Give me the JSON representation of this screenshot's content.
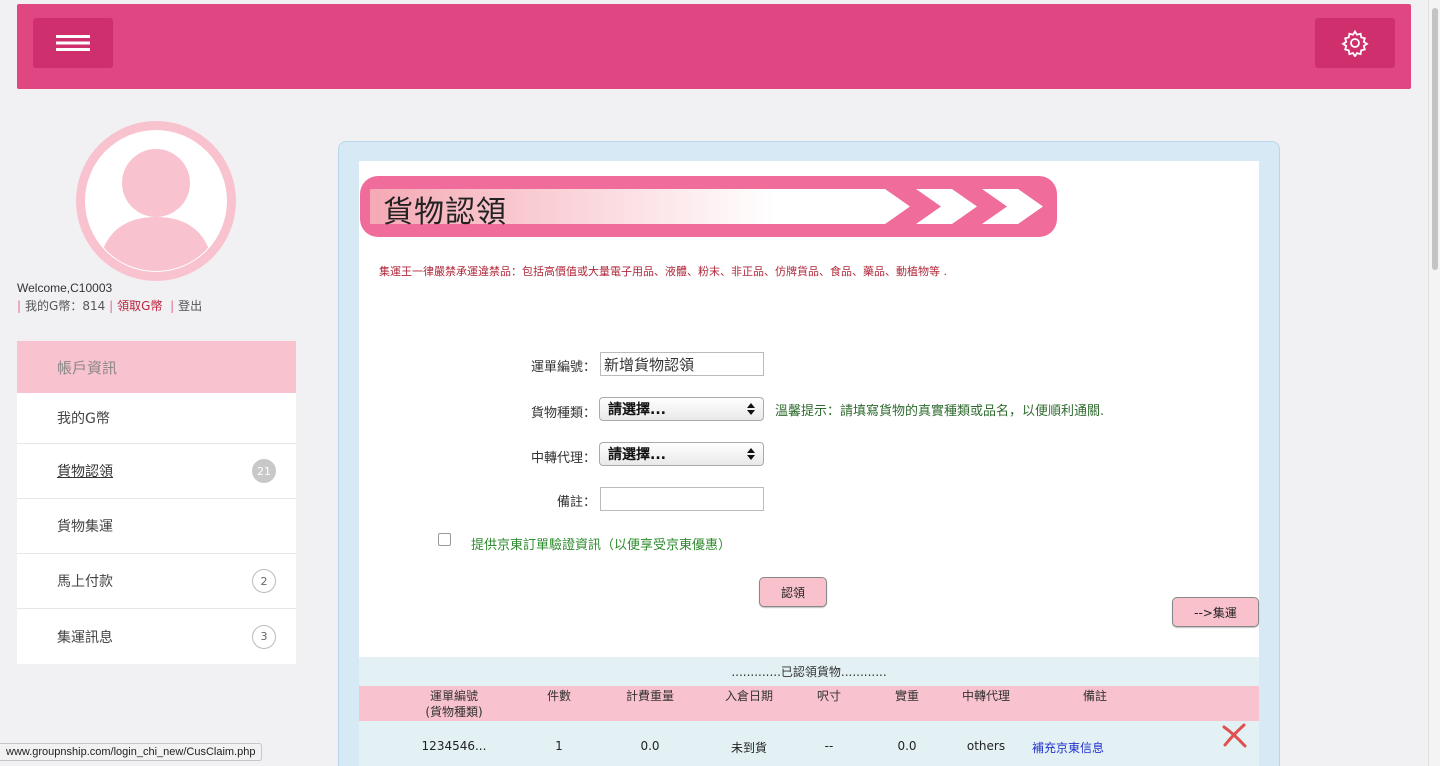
{
  "header": {
    "menu_icon": "hamburger-icon",
    "settings_icon": "gear-icon"
  },
  "user": {
    "welcome": "Welcome,C10003",
    "coins_text": "我的G幣：814",
    "get_coins": "領取G幣",
    "logout": "登出"
  },
  "sidebar": {
    "header": "帳戶資訊",
    "items": [
      {
        "label": "我的G幣",
        "badge": ""
      },
      {
        "label": "貨物認領",
        "badge": "21"
      },
      {
        "label": "貨物集運",
        "badge": ""
      },
      {
        "label": "馬上付款",
        "badge": "2"
      },
      {
        "label": "集運訊息",
        "badge": "3"
      }
    ]
  },
  "page": {
    "title": "貨物認領",
    "notice": "集運王一律嚴禁承運違禁品：包括高價值或大量電子用品、液體、粉末、非正品、仿牌貨品、食品、藥品、動植物等 ."
  },
  "form": {
    "waybill_label": "運單編號：",
    "waybill_value": "新增貨物認領",
    "type_label": "貨物種類：",
    "type_value": "請選擇...",
    "type_hint": "溫馨提示：請填寫貨物的真實種類或品名，以便順利通關.",
    "agent_label": "中轉代理：",
    "agent_value": "請選擇...",
    "remark_label": "備註：",
    "remark_value": "",
    "jd_checkbox_label": "提供京東訂單驗證資訊（以便享受京東優惠）",
    "claim_button": "認領",
    "ship_button": "-->集運"
  },
  "claimed": {
    "section_label": ".............已認領貨物............",
    "columns": [
      "運單編號\n(貨物種類)",
      "件數",
      "計費重量",
      "入倉日期",
      "呎寸",
      "實重",
      "中轉代理",
      "備註"
    ],
    "rows": [
      {
        "waybill": "1234546...",
        "pieces": "1",
        "charge_weight": "0.0",
        "date": "未到貨",
        "size": "--",
        "actual_weight": "0.0",
        "agent": "others",
        "remark": "補充京東信息"
      }
    ]
  },
  "status_bar": {
    "url": "www.groupnship.com/login_chi_new/CusClaim.php"
  },
  "colors": {
    "brand": "#e04681",
    "brand_dark": "#cf2f6c",
    "pink_light": "#f9c2cf",
    "notice_red": "#b0283b",
    "hint_green": "#2f6b2f"
  }
}
